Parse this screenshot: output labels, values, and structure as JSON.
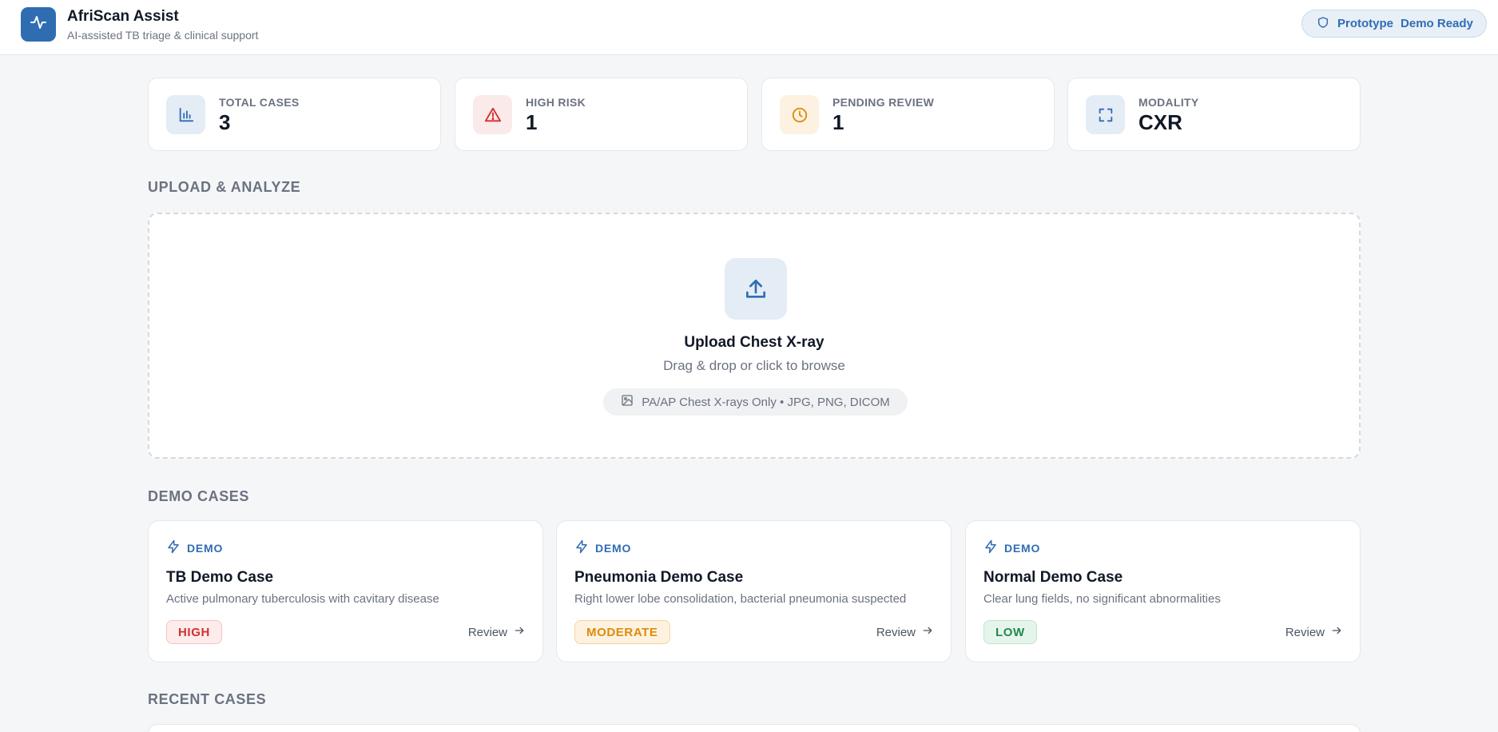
{
  "header": {
    "app_title": "AfriScan Assist",
    "app_subtitle": "AI-assisted TB triage & clinical support",
    "logo_icon": "pulse-icon",
    "status": {
      "icon": "shield-icon",
      "label": "Prototype",
      "value": "Demo Ready"
    }
  },
  "stats": [
    {
      "label": "TOTAL CASES",
      "value": "3",
      "icon": "bar-chart-icon",
      "color": "#2f6db3"
    },
    {
      "label": "HIGH RISK",
      "value": "1",
      "icon": "warning-icon",
      "color": "#d32f2f"
    },
    {
      "label": "PENDING REVIEW",
      "value": "1",
      "icon": "clock-icon",
      "color": "#e08a0b"
    },
    {
      "label": "MODALITY",
      "value": "CXR",
      "icon": "scan-icon",
      "color": "#2f6db3"
    }
  ],
  "upload": {
    "section_title": "UPLOAD & ANALYZE",
    "title": "Upload Chest X-ray",
    "subtitle": "Drag & drop or click to browse",
    "formats": "PA/AP Chest X-rays Only • JPG, PNG, DICOM",
    "icon": "upload-icon"
  },
  "demo": {
    "section_title": "DEMO CASES",
    "cards": [
      {
        "tag": "DEMO",
        "title": "TB Demo Case",
        "description": "Active pulmonary tuberculosis with cavitary disease",
        "risk": "HIGH",
        "action": "Review"
      },
      {
        "tag": "DEMO",
        "title": "Pneumonia Demo Case",
        "description": "Right lower lobe consolidation, bacterial pneumonia suspected",
        "risk": "MODERATE",
        "action": "Review"
      },
      {
        "tag": "DEMO",
        "title": "Normal Demo Case",
        "description": "Clear lung fields, no significant abnormalities",
        "risk": "LOW",
        "action": "Review"
      }
    ]
  },
  "recent": {
    "section_title": "RECENT CASES"
  },
  "colors": {
    "brand": "#2f6db3",
    "high": "#d32f2f",
    "moderate": "#e08a0b",
    "low": "#1f8a4c"
  }
}
